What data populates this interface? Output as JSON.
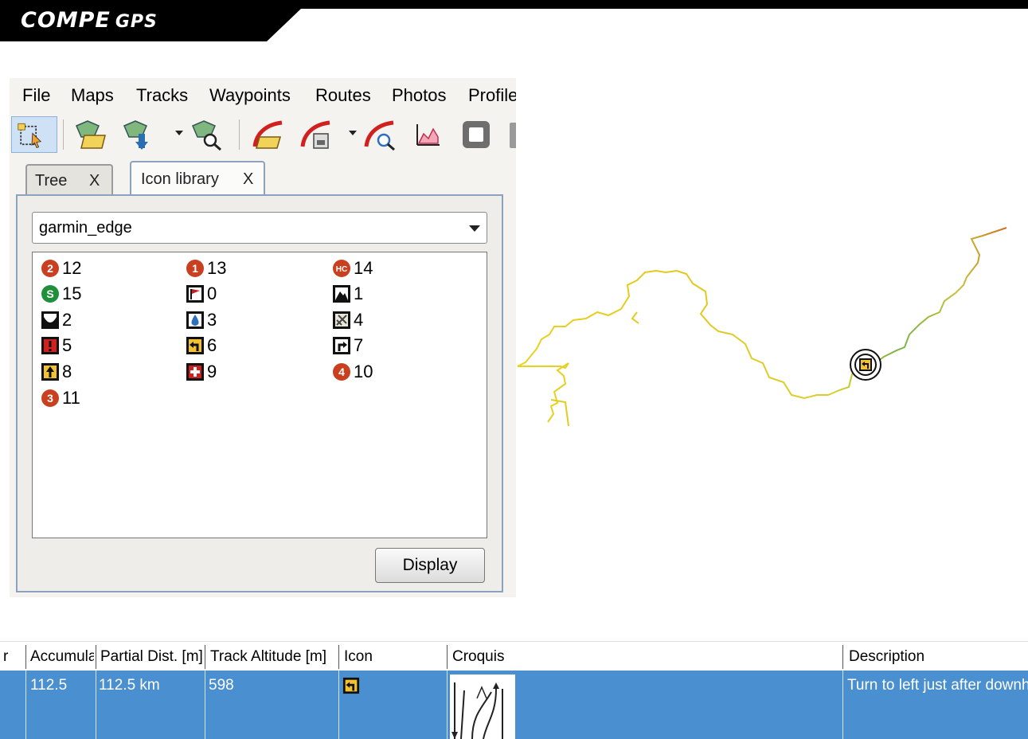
{
  "brand": {
    "name": "COMPE",
    "suffix": "GPS"
  },
  "menu": [
    "File",
    "Maps",
    "Tracks",
    "Waypoints",
    "Routes",
    "Photos",
    "Profile"
  ],
  "toolbar_icons": [
    "select-tool-icon",
    "open-map-icon",
    "map-download-icon",
    "map-find-icon",
    "open-track-icon",
    "track-save-icon",
    "track-find-icon",
    "profile-chart-icon",
    "stop-icon"
  ],
  "tabs": [
    {
      "label": "Tree",
      "close": "X"
    },
    {
      "label": "Icon library",
      "close": "X"
    }
  ],
  "library": {
    "selected": "garmin_edge",
    "icons": [
      {
        "icon": "circle-2-icon",
        "label": "12",
        "color": "#c8401f"
      },
      {
        "icon": "circle-1-icon",
        "label": "13",
        "color": "#c8401f"
      },
      {
        "icon": "circle-hc-icon",
        "label": "14",
        "color": "#c8401f"
      },
      {
        "icon": "circle-s-icon",
        "label": "15",
        "color": "#1f8f3a"
      },
      {
        "icon": "flag-icon",
        "label": "0",
        "color": "#c81f1f"
      },
      {
        "icon": "summit-icon",
        "label": "1",
        "color": "#000000"
      },
      {
        "icon": "valley-icon",
        "label": "2",
        "color": "#000000"
      },
      {
        "icon": "water-icon",
        "label": "3",
        "color": "#2f6fc0"
      },
      {
        "icon": "food-icon",
        "label": "4",
        "color": "#000000"
      },
      {
        "icon": "danger-icon",
        "label": "5",
        "color": "#d02020"
      },
      {
        "icon": "turn-left-icon",
        "label": "6",
        "color": "#f2c230"
      },
      {
        "icon": "turn-right-icon",
        "label": "7",
        "color": "#000000"
      },
      {
        "icon": "straight-icon",
        "label": "8",
        "color": "#f2c230"
      },
      {
        "icon": "first-aid-icon",
        "label": "9",
        "color": "#d02020"
      },
      {
        "icon": "circle-4-icon",
        "label": "10",
        "color": "#c8401f"
      },
      {
        "icon": "circle-3-icon",
        "label": "11",
        "color": "#c8401f"
      }
    ],
    "display_label": "Display"
  },
  "table": {
    "headers": [
      "r",
      "Accumula",
      "Partial Dist. [m]",
      "Track Altitude [m]",
      "Icon",
      "Croquis",
      "Description"
    ],
    "row": {
      "accumulated": "112.5",
      "partial": "112.5 km",
      "altitude": "598",
      "icon": "turn-left-icon",
      "description": "Turn to left just after downhill"
    }
  }
}
